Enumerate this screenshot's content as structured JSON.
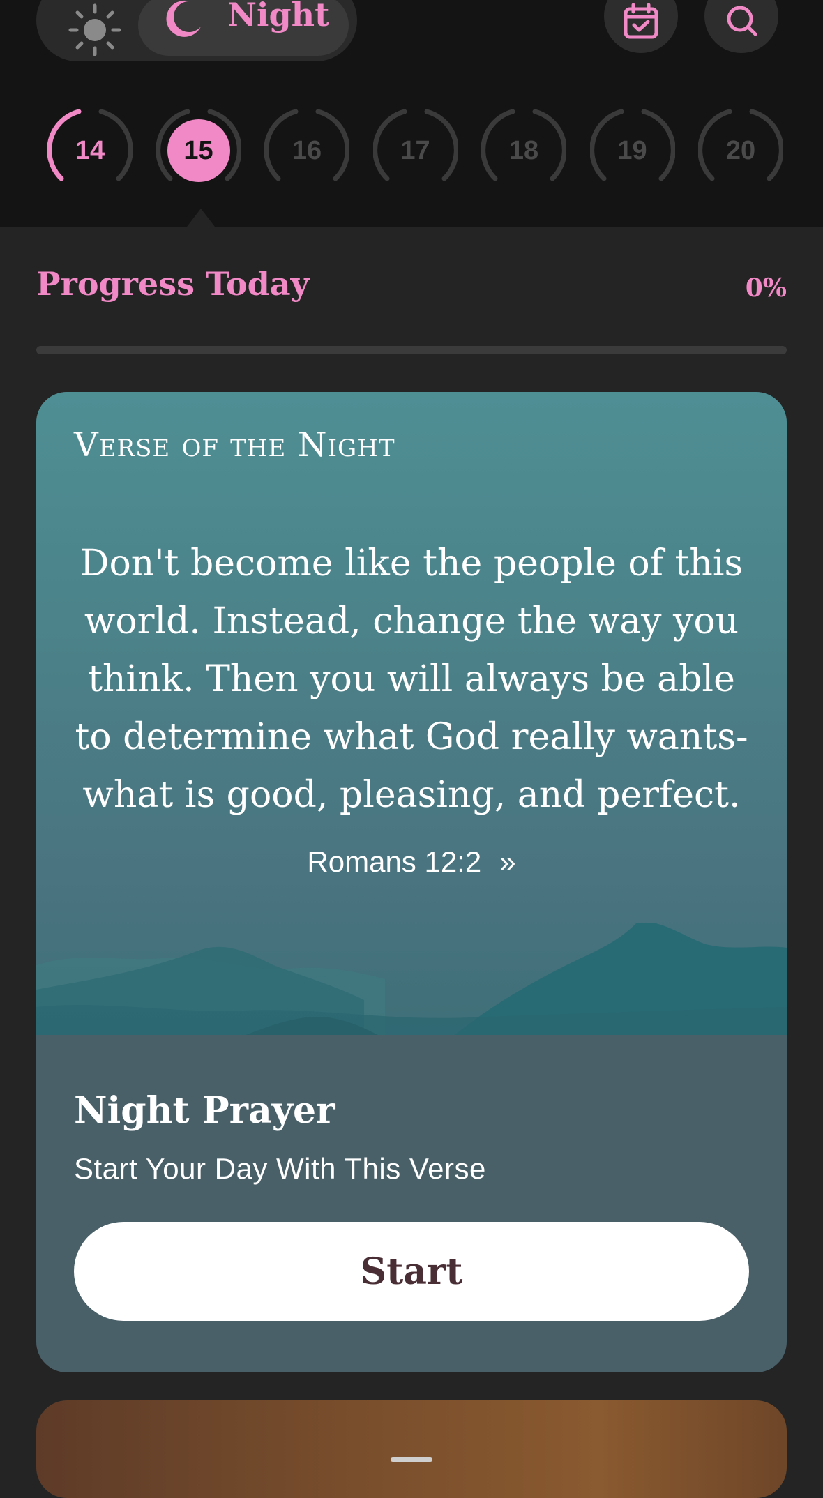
{
  "header": {
    "mode_label": "Night",
    "sun_icon": "sun-icon",
    "moon_icon": "moon-icon",
    "calendar_icon": "calendar-check-icon",
    "search_icon": "search-icon",
    "accent_color": "#f089c6"
  },
  "days": [
    {
      "num": "14",
      "state": "done"
    },
    {
      "num": "15",
      "state": "active"
    },
    {
      "num": "16",
      "state": "upcoming"
    },
    {
      "num": "17",
      "state": "upcoming"
    },
    {
      "num": "18",
      "state": "upcoming"
    },
    {
      "num": "19",
      "state": "upcoming"
    },
    {
      "num": "20",
      "state": "upcoming"
    }
  ],
  "progress": {
    "title": "Progress Today",
    "percent_label": "0%",
    "value": 0
  },
  "verse_card": {
    "heading": "Verse of the Night",
    "text": "Don't become like the people of this world. Instead, change the way you think. Then you will always be able to determine what God really wants- what is good, pleasing, and perfect.",
    "reference": "Romans 12:2",
    "chevron": "»",
    "prayer_title": "Night Prayer",
    "prayer_subtitle": "Start Your Day With This Verse",
    "start_label": "Start"
  }
}
